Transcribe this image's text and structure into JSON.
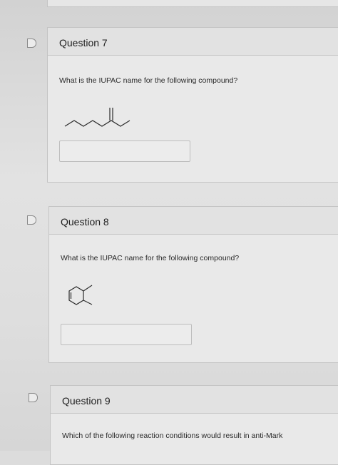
{
  "questions": [
    {
      "title": "Question 7",
      "prompt": "What is the IUPAC name for the following compound?",
      "answer_value": "",
      "answer_placeholder": ""
    },
    {
      "title": "Question 8",
      "prompt": "What is the IUPAC name for the following compound?",
      "answer_value": "",
      "answer_placeholder": ""
    },
    {
      "title": "Question 9",
      "prompt": "Which of the following reaction conditions would result in anti-Mark"
    }
  ],
  "colors": {
    "background": "#dcdcdc",
    "card": "#e9e9e9",
    "border": "#c4c4c4",
    "text": "#222222"
  },
  "icons": [
    "flag-icon",
    "skeletal-structure-ketone",
    "skeletal-structure-cyclohexene"
  ]
}
